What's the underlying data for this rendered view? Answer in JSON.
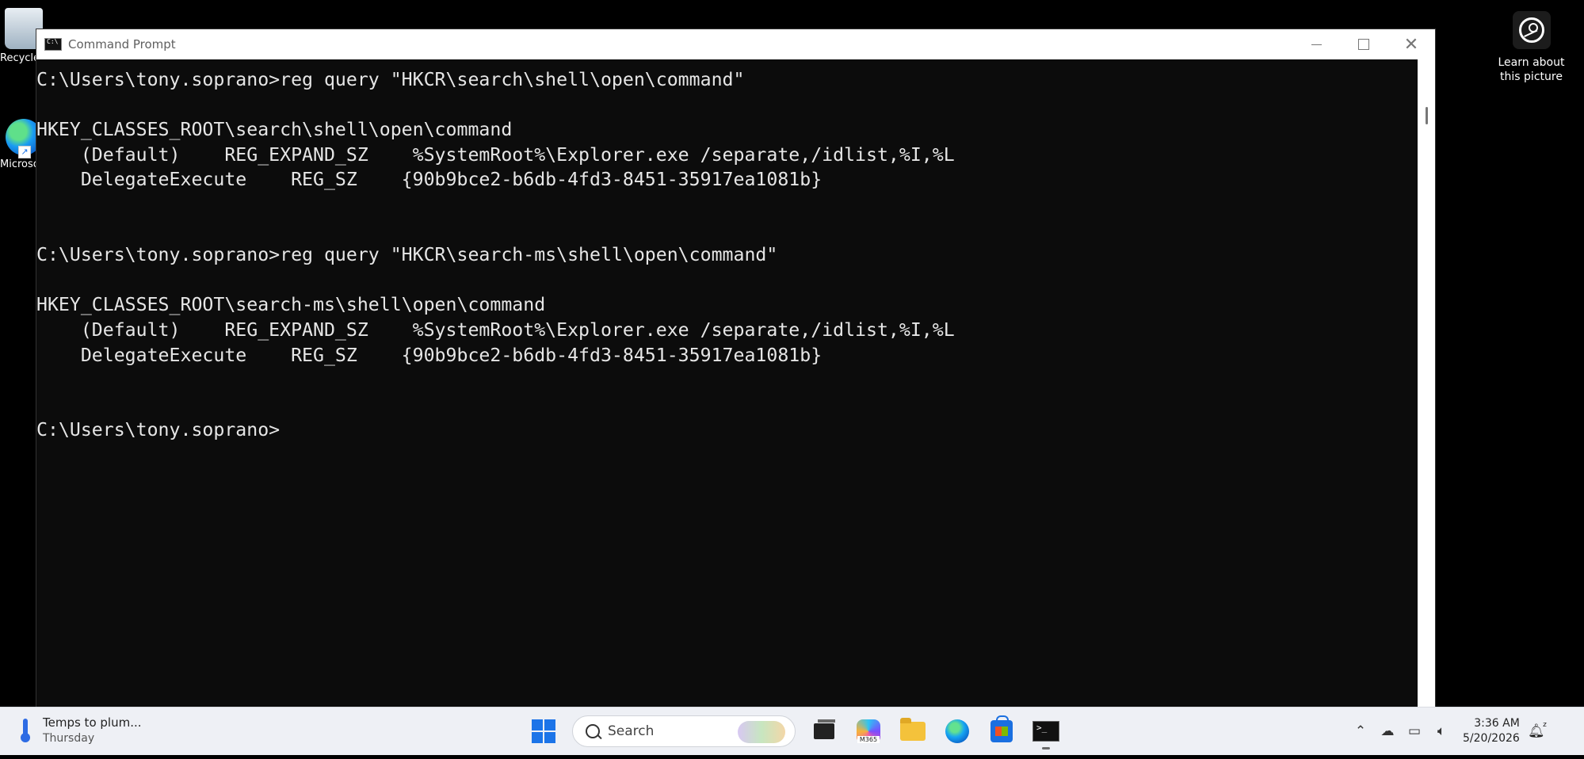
{
  "desktop": {
    "icons": [
      {
        "label": "Recycle Bin"
      },
      {
        "label": "Microsoft Edge"
      }
    ],
    "learn_about_picture": {
      "line1": "Learn about",
      "line2": "this picture"
    }
  },
  "window": {
    "title": "Command Prompt",
    "console_lines": [
      "C:\\Users\\tony.soprano>reg query \"HKCR\\search\\shell\\open\\command\"",
      "",
      "HKEY_CLASSES_ROOT\\search\\shell\\open\\command",
      "    (Default)    REG_EXPAND_SZ    %SystemRoot%\\Explorer.exe /separate,/idlist,%I,%L",
      "    DelegateExecute    REG_SZ    {90b9bce2-b6db-4fd3-8451-35917ea1081b}",
      "",
      "",
      "C:\\Users\\tony.soprano>reg query \"HKCR\\search-ms\\shell\\open\\command\"",
      "",
      "HKEY_CLASSES_ROOT\\search-ms\\shell\\open\\command",
      "    (Default)    REG_EXPAND_SZ    %SystemRoot%\\Explorer.exe /separate,/idlist,%I,%L",
      "    DelegateExecute    REG_SZ    {90b9bce2-b6db-4fd3-8451-35917ea1081b}",
      "",
      "",
      "C:\\Users\\tony.soprano>"
    ]
  },
  "taskbar": {
    "weather": {
      "title": "Temps to plum...",
      "subtitle": "Thursday"
    },
    "search_placeholder": "Search",
    "m365_label": "M365",
    "clock": {
      "time": "3:36 AM",
      "date": "5/20/2026"
    },
    "tray_icons": [
      "chevron-up-icon",
      "cloud-off-icon",
      "network-icon",
      "volume-icon",
      "notification-bell-icon"
    ]
  }
}
